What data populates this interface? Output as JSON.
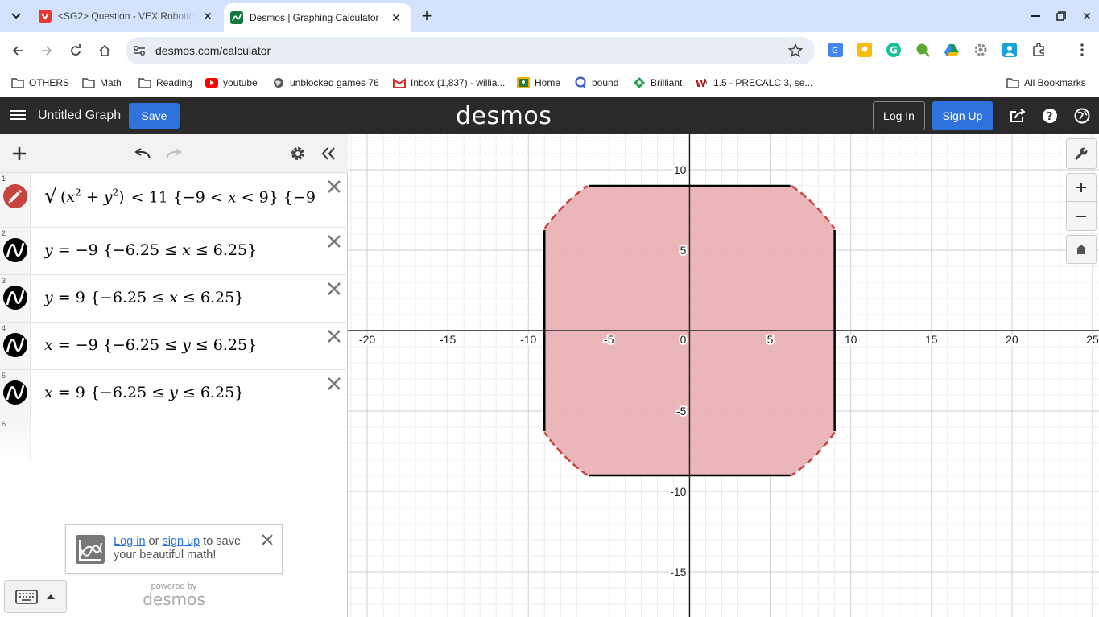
{
  "browser": {
    "tabs": [
      {
        "title": "<SG2> Question - VEX Robotics",
        "favicon": "vex-favicon-icon",
        "active": false
      },
      {
        "title": "Desmos | Graphing Calculator",
        "favicon": "desmos-favicon-icon",
        "active": true
      }
    ],
    "url": "desmos.com/calculator",
    "bookmarks": [
      {
        "label": "OTHERS",
        "icon": "folder-icon"
      },
      {
        "label": "Math",
        "icon": "folder-icon"
      },
      {
        "label": "Reading",
        "icon": "folder-icon"
      },
      {
        "label": "youtube",
        "icon": "youtube-icon"
      },
      {
        "label": "unblocked games 76",
        "icon": "globe-icon"
      },
      {
        "label": "Inbox (1,837) - willia...",
        "icon": "gmail-icon"
      },
      {
        "label": "Home",
        "icon": "classroom-icon"
      },
      {
        "label": "bound",
        "icon": "bound-icon"
      },
      {
        "label": "Brilliant",
        "icon": "brilliant-icon"
      },
      {
        "label": "1.5 - PRECALC 3, se...",
        "icon": "webassign-icon"
      }
    ],
    "all_bookmarks": "All Bookmarks"
  },
  "desmos": {
    "title": "Untitled Graph",
    "save": "Save",
    "logo": "desmos",
    "login": "Log In",
    "signup": "Sign Up",
    "expressions": [
      {
        "num": "1"
      },
      {
        "num": "2"
      },
      {
        "num": "3"
      },
      {
        "num": "4"
      },
      {
        "num": "5"
      },
      {
        "num": "6"
      }
    ],
    "toast": {
      "login": "Log in",
      "or": "or",
      "signup": "sign up",
      "rest": "to save your beautiful math!"
    },
    "powered_by": "powered by",
    "powered_logo": "desmos",
    "colors": {
      "fill": "#e8a9ad",
      "stroke": "#c74440",
      "header": "#2a2a2a",
      "accent": "#2f72dc"
    }
  },
  "graph": {
    "x_ticks": [
      "-20",
      "-15",
      "-10",
      "-5",
      "0",
      "5",
      "10",
      "15",
      "20",
      "25"
    ],
    "y_ticks": [
      "10",
      "5",
      "-5",
      "-10",
      "-15"
    ],
    "xlim": [
      -21.2,
      25.4
    ],
    "ylim": [
      -17.8,
      12.2
    ]
  }
}
